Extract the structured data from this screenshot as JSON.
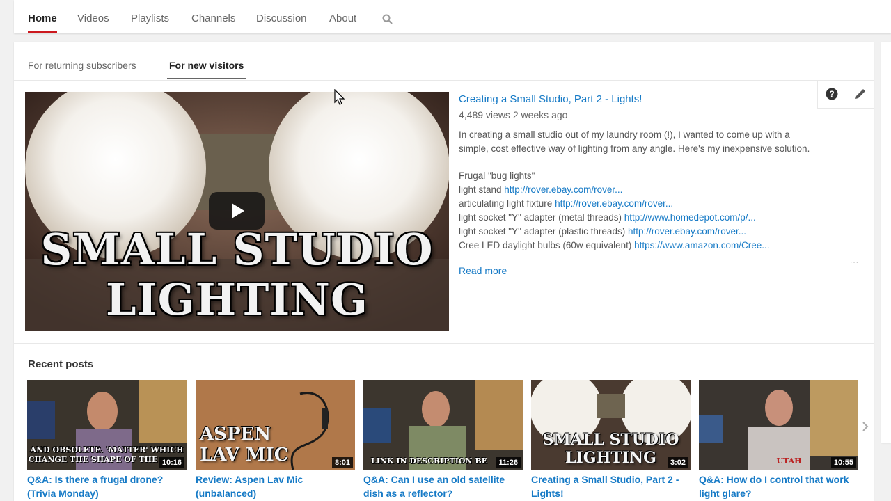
{
  "nav": {
    "tabs": [
      "Home",
      "Videos",
      "Playlists",
      "Channels",
      "Discussion",
      "About"
    ],
    "active": "Home",
    "search_icon": "search-icon"
  },
  "subtabs": [
    "For returning subscribers",
    "For new visitors"
  ],
  "subtab_active": "For new visitors",
  "tools": {
    "help_icon": "help-icon",
    "edit_icon": "pencil-icon"
  },
  "featured": {
    "title": "Creating a Small Studio, Part 2 - Lights!",
    "meta": "4,489 views  2 weeks ago",
    "thumb_text_line1": "SMALL STUDIO",
    "thumb_text_line2": "LIGHTING",
    "desc_intro_1": "In creating a small studio out of my laundry room (!), I wanted to come up with a",
    "desc_intro_2": "simple, cost effective way of lighting from any angle. Here's my inexpensive solution.",
    "items": [
      {
        "text": "Frugal \"bug lights\"",
        "link": ""
      },
      {
        "text": "light stand ",
        "link": "http://rover.ebay.com/rover..."
      },
      {
        "text": "articulating light fixture ",
        "link": "http://rover.ebay.com/rover..."
      },
      {
        "text": "light socket \"Y\" adapter (metal threads) ",
        "link": "http://www.homedepot.com/p/..."
      },
      {
        "text": "light socket \"Y\" adapter (plastic threads) ",
        "link": "http://rover.ebay.com/rover..."
      },
      {
        "text": "Cree LED daylight bulbs (60w equivalent) ",
        "link": "https://www.amazon.com/Cree..."
      }
    ],
    "read_more": "Read more",
    "dots": "···"
  },
  "recent": {
    "title": "Recent posts",
    "posts": [
      {
        "title_1": "Q&A: Is there a frugal drone?",
        "title_2": "(Trivia Monday)",
        "duration": "10:16",
        "caption_1": "AND OBSOLETE. 'MATTER' WHICH",
        "caption_2": "CHANGE THE SHAPE OF THE"
      },
      {
        "title_1": "Review: Aspen Lav Mic",
        "title_2": "(unbalanced)",
        "duration": "8:01",
        "caption_1": "ASPEN",
        "caption_2": "LAV MIC"
      },
      {
        "title_1": "Q&A: Can I use an old satellite",
        "title_2": "dish as a reflector?",
        "duration": "11:26",
        "caption_1": "LINK IN DESCRIPTION BE",
        "caption_2": ""
      },
      {
        "title_1": "Creating a Small Studio, Part 2 -",
        "title_2": "Lights!",
        "duration": "3:02",
        "caption_1": "SMALL STUDIO",
        "caption_2": "LIGHTING"
      },
      {
        "title_1": "Q&A: How do I control that work",
        "title_2": "light glare?",
        "duration": "10:55",
        "caption_1": "UTAH",
        "caption_2": ""
      }
    ],
    "next_icon": "chevron-right-icon"
  },
  "colors": {
    "accent": "#cc181e",
    "link": "#167ac6"
  }
}
